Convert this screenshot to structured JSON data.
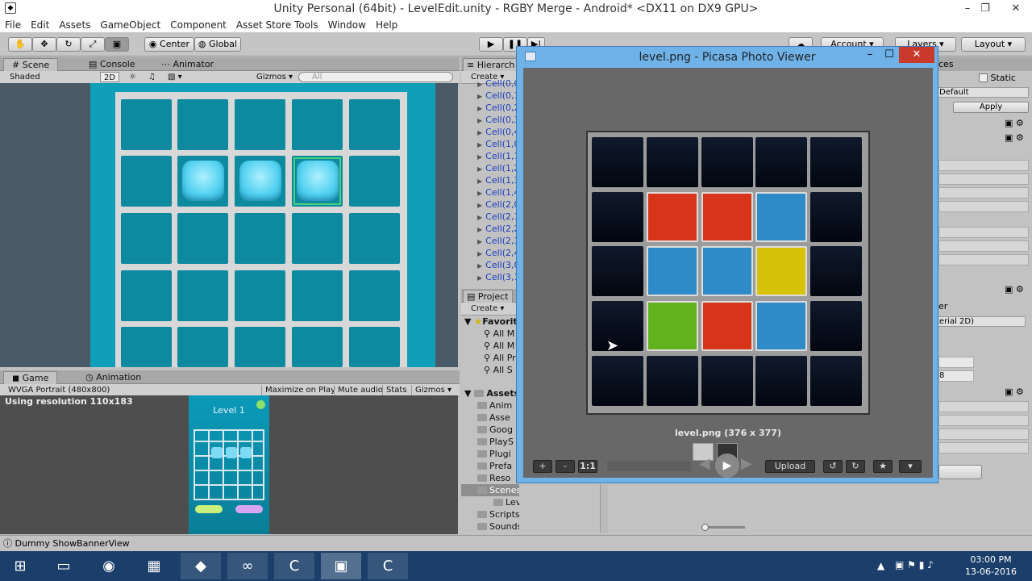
{
  "window": {
    "title": "Unity Personal (64bit) - LevelEdit.unity - RGBY Merge - Android* <DX11 on DX9 GPU>"
  },
  "menu": [
    "File",
    "Edit",
    "Assets",
    "GameObject",
    "Component",
    "Asset Store Tools",
    "Window",
    "Help"
  ],
  "toolbar": {
    "center": "Center",
    "global": "Global",
    "account": "Account",
    "layers": "Layers",
    "layout": "Layout"
  },
  "scene": {
    "tab": "Scene",
    "console_tab": "Console",
    "animator_tab": "Animator",
    "shading": "Shaded",
    "mode2d": "2D",
    "gizmos": "Gizmos",
    "search_placeholder": "All"
  },
  "game": {
    "tab": "Game",
    "animation_tab": "Animation",
    "resolution": "WVGA Portrait (480x800)",
    "maximize": "Maximize on Play",
    "mute": "Mute audio",
    "stats": "Stats",
    "gizmos": "Gizmos",
    "using_resolution": "Using resolution 110x183",
    "level_label": "Level 1"
  },
  "hierarchy": {
    "tab": "Hierarch",
    "create": "Create",
    "items": [
      "Cell(0,0",
      "Cell(0,1",
      "Cell(0,2",
      "Cell(0,3",
      "Cell(0,4",
      "Cell(1,0",
      "Cell(1,1",
      "Cell(1,2",
      "Cell(1,3",
      "Cell(1,4",
      "Cell(2,0",
      "Cell(2,1",
      "Cell(2,2",
      "Cell(2,3",
      "Cell(2,4",
      "Cell(3,0",
      "Cell(3,1"
    ]
  },
  "project": {
    "tab": "Project",
    "create": "Create",
    "favorites": "Favorit",
    "fav_items": [
      "All M",
      "All M",
      "All Pr",
      "All S"
    ],
    "assets": "Assets",
    "asset_items": [
      "Anim",
      "Asse",
      "Goog",
      "PlayS",
      "Plugi",
      "Prefa",
      "Reso",
      "Scenes",
      "Levels",
      "Scripts",
      "Sounds"
    ]
  },
  "inspector": {
    "tab": "ces",
    "static": "Static",
    "default": "Default",
    "apply": "Apply",
    "material": "terial 2D)",
    "value": "8",
    "label_er": "er"
  },
  "picasa": {
    "title": "level.png - Picasa Photo Viewer",
    "caption": "level.png (376 x 377)",
    "upload": "Upload",
    "ratio": "1:1"
  },
  "status": {
    "text": "Dummy ShowBannerView"
  },
  "tray": {
    "time": "03:00 PM",
    "date": "13-06-2016"
  }
}
